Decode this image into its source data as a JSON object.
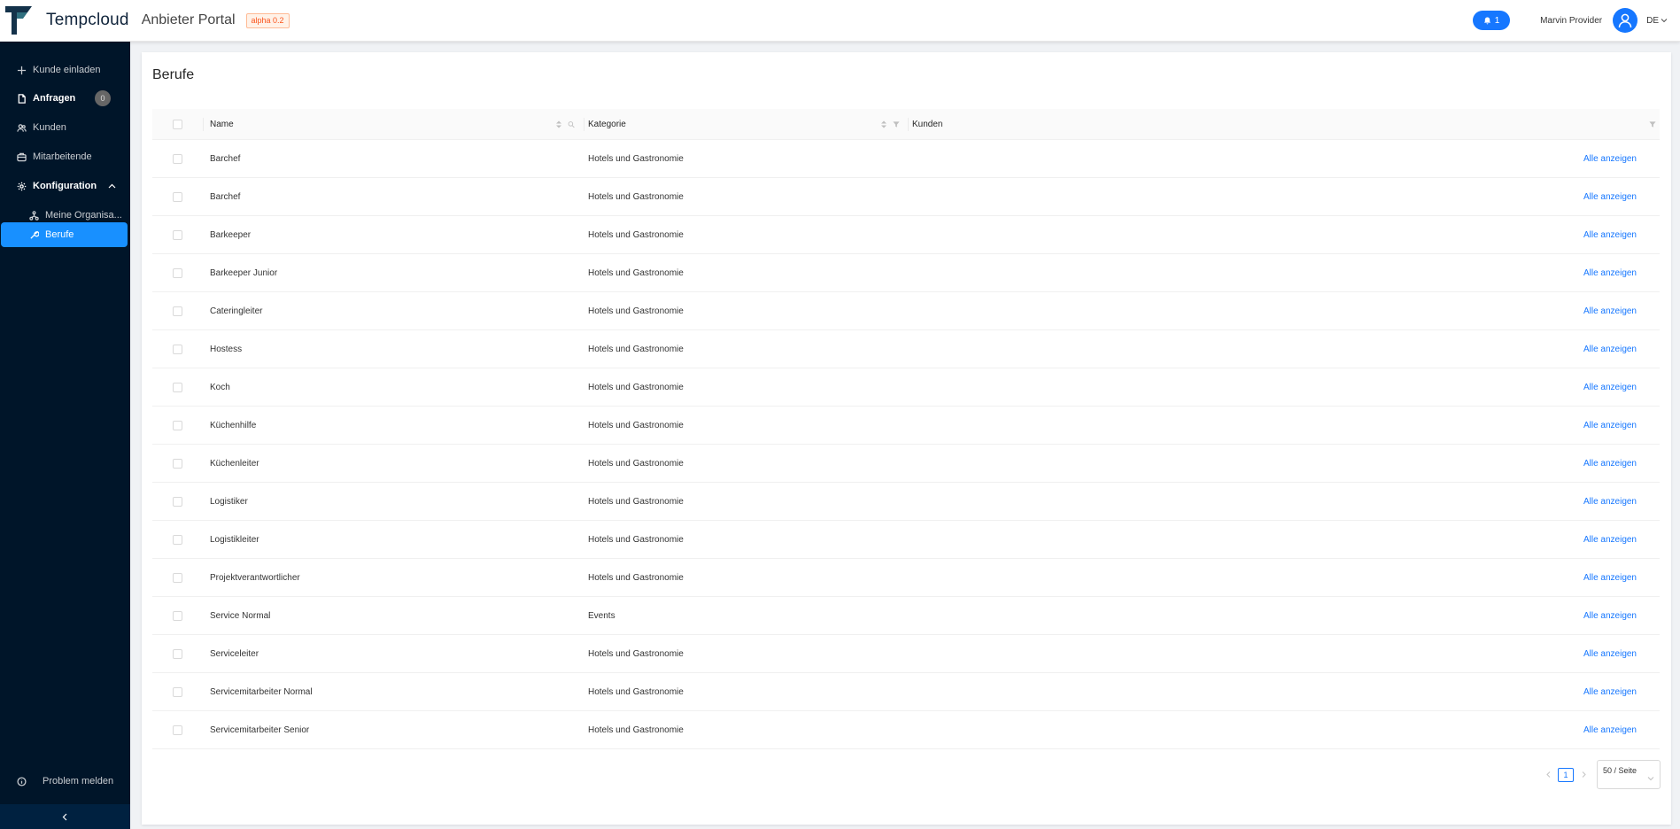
{
  "header": {
    "brand": "Tempcloud",
    "portal": "Anbieter Portal",
    "version": "alpha 0.2",
    "notifications": "1",
    "user_name": "Marvin Provider",
    "language": "DE"
  },
  "sidebar": {
    "items": [
      {
        "label": "Kunde einladen",
        "icon": "plus-icon"
      },
      {
        "label": "Anfragen",
        "icon": "document-icon",
        "badge": "0"
      },
      {
        "label": "Kunden",
        "icon": "users-icon"
      },
      {
        "label": "Mitarbeitende",
        "icon": "team-icon"
      },
      {
        "label": "Konfiguration",
        "icon": "gear-icon"
      },
      {
        "label": "Meine Organisa...",
        "icon": "organization-icon"
      },
      {
        "label": "Berufe",
        "icon": "tool-icon"
      }
    ],
    "footer_item": "Problem melden"
  },
  "page": {
    "title": "Berufe"
  },
  "table": {
    "columns": {
      "name": "Name",
      "category": "Kategorie",
      "customers": "Kunden"
    },
    "rows": [
      {
        "name": "Barchef",
        "category": "Hotels und Gastronomie",
        "action": "Alle anzeigen"
      },
      {
        "name": "Barchef",
        "category": "Hotels und Gastronomie",
        "action": "Alle anzeigen"
      },
      {
        "name": "Barkeeper",
        "category": "Hotels und Gastronomie",
        "action": "Alle anzeigen"
      },
      {
        "name": "Barkeeper Junior",
        "category": "Hotels und Gastronomie",
        "action": "Alle anzeigen"
      },
      {
        "name": "Cateringleiter",
        "category": "Hotels und Gastronomie",
        "action": "Alle anzeigen"
      },
      {
        "name": "Hostess",
        "category": "Hotels und Gastronomie",
        "action": "Alle anzeigen"
      },
      {
        "name": "Koch",
        "category": "Hotels und Gastronomie",
        "action": "Alle anzeigen"
      },
      {
        "name": "Küchenhilfe",
        "category": "Hotels und Gastronomie",
        "action": "Alle anzeigen"
      },
      {
        "name": "Küchenleiter",
        "category": "Hotels und Gastronomie",
        "action": "Alle anzeigen"
      },
      {
        "name": "Logistiker",
        "category": "Hotels und Gastronomie",
        "action": "Alle anzeigen"
      },
      {
        "name": "Logistikleiter",
        "category": "Hotels und Gastronomie",
        "action": "Alle anzeigen"
      },
      {
        "name": "Projektverantwortlicher",
        "category": "Hotels und Gastronomie",
        "action": "Alle anzeigen"
      },
      {
        "name": "Service Normal",
        "category": "Events",
        "action": "Alle anzeigen"
      },
      {
        "name": "Serviceleiter",
        "category": "Hotels und Gastronomie",
        "action": "Alle anzeigen"
      },
      {
        "name": "Servicemitarbeiter Normal",
        "category": "Hotels und Gastronomie",
        "action": "Alle anzeigen"
      },
      {
        "name": "Servicemitarbeiter Senior",
        "category": "Hotels und Gastronomie",
        "action": "Alle anzeigen"
      }
    ]
  },
  "pagination": {
    "current_page": "1",
    "page_size": "50 / Seite"
  },
  "colors": {
    "sidebar_bg": "#001529",
    "accent": "#1677ff",
    "active_menu": "#1890ff"
  }
}
